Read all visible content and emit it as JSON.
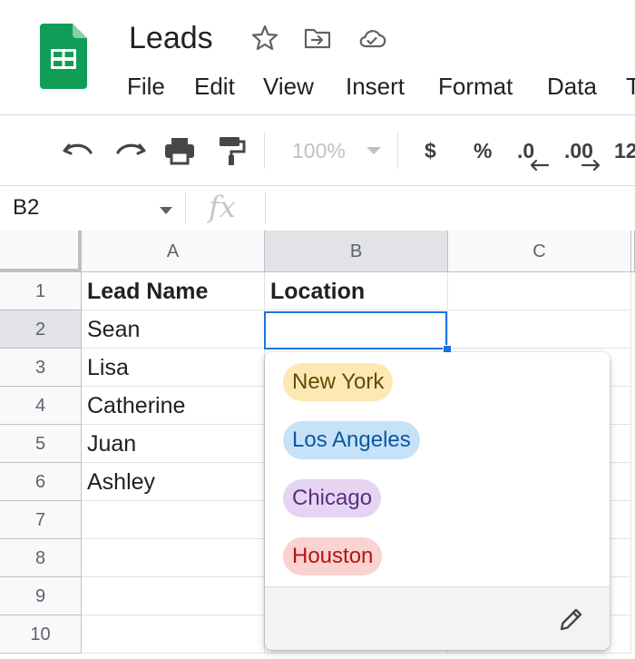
{
  "header": {
    "doc_title": "Leads",
    "icons": [
      "star-icon",
      "move-to-folder-icon",
      "cloud-saved-icon"
    ],
    "menu": [
      "File",
      "Edit",
      "View",
      "Insert",
      "Format",
      "Data",
      "T"
    ]
  },
  "toolbar": {
    "zoom": "100%",
    "currency": "$",
    "percent": "%",
    "decrease_decimal": ".0",
    "increase_decimal": ".00",
    "more_formats": "12"
  },
  "formula_bar": {
    "name_box": "B2",
    "fx_label": "fx",
    "value": ""
  },
  "sheet": {
    "columns": [
      "A",
      "B",
      "C"
    ],
    "rows": [
      "1",
      "2",
      "3",
      "4",
      "5",
      "6",
      "7",
      "8",
      "9",
      "10"
    ],
    "selected_cell": "B2",
    "cells": {
      "A1": "Lead Name",
      "B1": "Location",
      "A2": "Sean",
      "A3": "Lisa",
      "A4": "Catherine",
      "A5": "Juan",
      "A6": "Ashley"
    }
  },
  "dropdown": {
    "options": [
      {
        "label": "New York",
        "bg": "#fce8b2",
        "fg": "#5f4c07"
      },
      {
        "label": "Los Angeles",
        "bg": "#c6e2f7",
        "fg": "#0b57a0"
      },
      {
        "label": "Chicago",
        "bg": "#e5d5f2",
        "fg": "#5b2c83"
      },
      {
        "label": "Houston",
        "bg": "#fad2cf",
        "fg": "#b31412"
      }
    ],
    "footer_icon": "edit-pencil-icon"
  },
  "colors": {
    "accent": "#1a73e8",
    "sheets_green": "#0f9d58"
  }
}
